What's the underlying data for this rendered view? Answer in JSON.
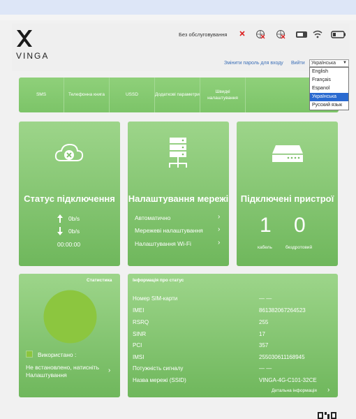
{
  "brand": {
    "logo_text": "VINGA"
  },
  "status_bar": {
    "service_text": "Без обслуговування"
  },
  "header_links": {
    "change_password": "Змінити пароль для входу",
    "logout": "Вийти"
  },
  "language": {
    "selected": "Українська",
    "options": [
      "English",
      "Français",
      "Espanol",
      "Українська",
      "Русский язык"
    ],
    "selected_index": 3
  },
  "menu": [
    {
      "label": "SMS"
    },
    {
      "label": "Телефонна книга"
    },
    {
      "label": "USSD"
    },
    {
      "label": "Додаткові параметри"
    },
    {
      "label": "Швидкі налаштування"
    }
  ],
  "connection": {
    "title": "Статус підключення",
    "upload": "0b/s",
    "download": "0b/s",
    "time": "00:00:00"
  },
  "network": {
    "title": "Налаштування мережі",
    "items": [
      "Автоматично",
      "Мережеві налаштування",
      "Налаштування Wi-Fi"
    ]
  },
  "devices": {
    "title": "Підключені пристрої",
    "cable_count": "1",
    "wireless_count": "0",
    "cable_label": "кабель",
    "wireless_label": "бездротовий"
  },
  "stats": {
    "title": "Статистика",
    "used_label": "Використано  :",
    "not_set_text": "Не встановлено, натисніть Налаштування"
  },
  "info": {
    "title": "Інформація про статус",
    "rows": [
      {
        "label": "Номер SIM-карти",
        "value": "— —"
      },
      {
        "label": "IMEI",
        "value": "861382067264523"
      },
      {
        "label": "RSRQ",
        "value": "255"
      },
      {
        "label": "SINR",
        "value": "17"
      },
      {
        "label": "PCI",
        "value": "357"
      },
      {
        "label": "IMSI",
        "value": "255030611168945"
      },
      {
        "label": "Потужність сигналу",
        "value": "— —"
      },
      {
        "label": "Назва мережі (SSID)",
        "value": "VINGA-4G-C101-32CE"
      }
    ],
    "detail_link": "Детальна інформація"
  },
  "colors": {
    "card_top": "#9dd58a",
    "card_bottom": "#6fb75c",
    "accent_link": "#3c6fb7",
    "pie": "#8cc63f"
  }
}
